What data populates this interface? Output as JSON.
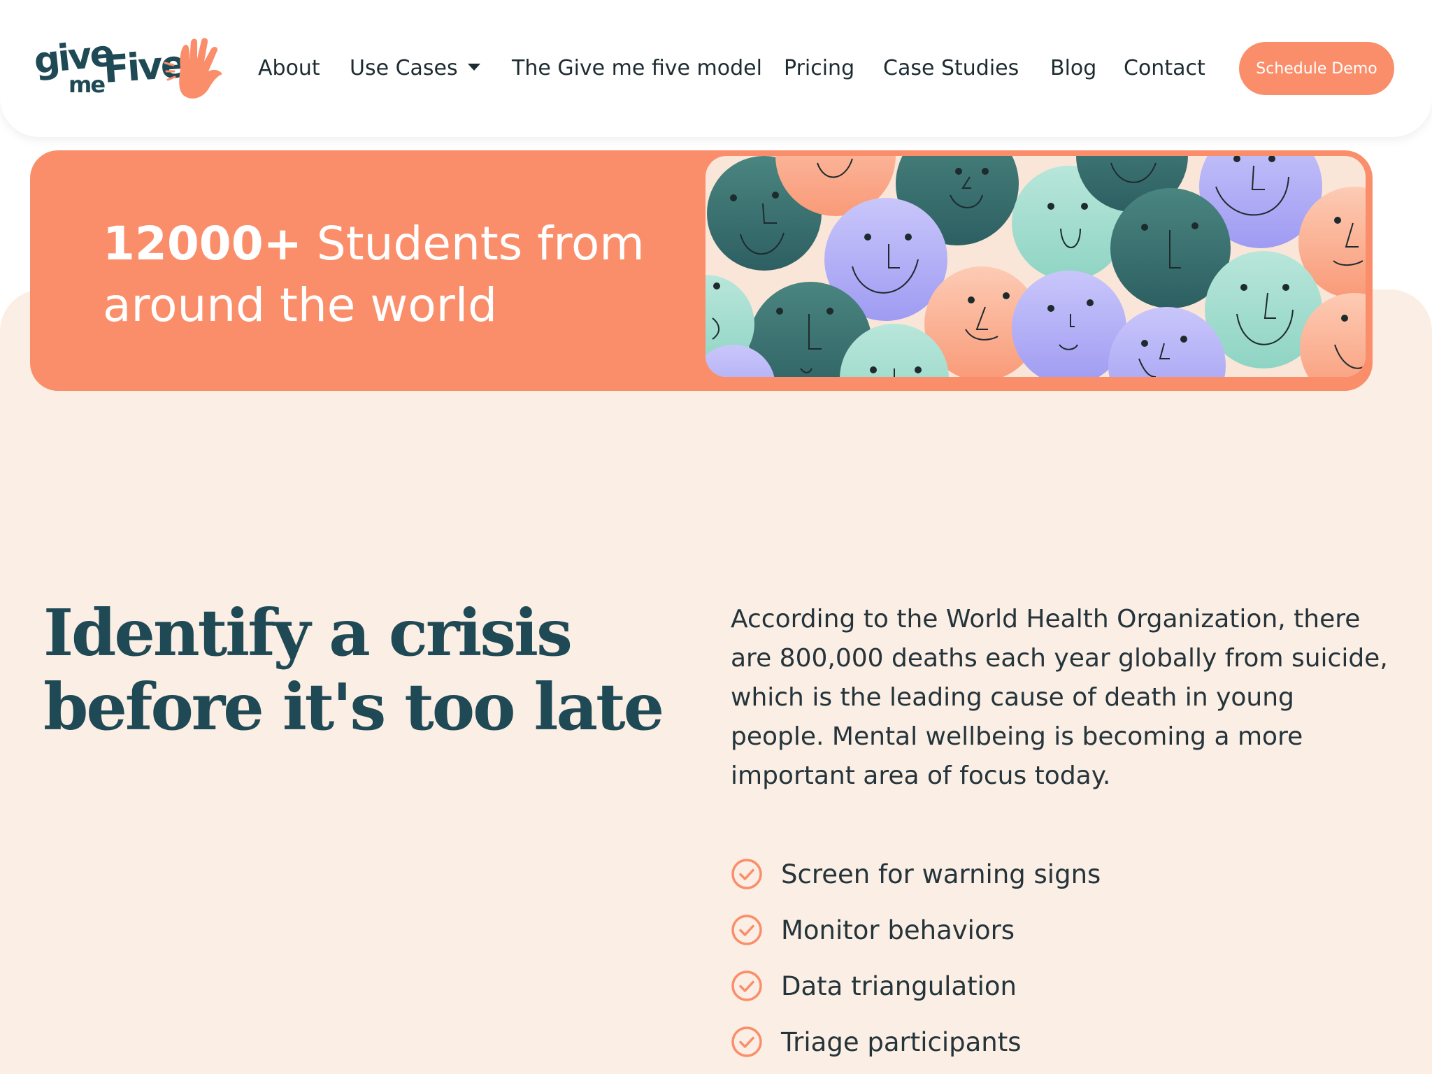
{
  "brand": {
    "logo_word_1": "give",
    "logo_word_2": "me",
    "logo_word_3": "Five",
    "logo_icon": "waving-hand-icon",
    "primary_color": "#fb8e6a",
    "dark_color": "#1f4a55",
    "cream_color": "#fbeee5"
  },
  "nav": {
    "items": [
      {
        "label": "About"
      },
      {
        "label": "Use Cases",
        "has_dropdown": true
      },
      {
        "label": "The Give me five model"
      },
      {
        "label": "Pricing"
      },
      {
        "label": "Case Studies"
      },
      {
        "label": "Blog"
      },
      {
        "label": "Contact"
      }
    ],
    "cta_label": "Schedule Demo"
  },
  "banner": {
    "highlight": "12000+",
    "text": " Students from around the world",
    "image": "smiley-faces-illustration"
  },
  "main": {
    "heading_line_1": "Identify a crisis",
    "heading_line_2": "before it's too late",
    "body": "According to the World Health Organization, there are 800,000 deaths each year globally from suicide, which is the leading cause of death in young people. Mental wellbeing is becoming a more important area of focus today.",
    "checklist": [
      {
        "label": "Screen for warning signs",
        "icon": "check-circle-icon"
      },
      {
        "label": "Monitor behaviors",
        "icon": "check-circle-icon"
      },
      {
        "label": "Data triangulation",
        "icon": "check-circle-icon"
      },
      {
        "label": "Triage participants",
        "icon": "check-circle-icon"
      }
    ]
  }
}
